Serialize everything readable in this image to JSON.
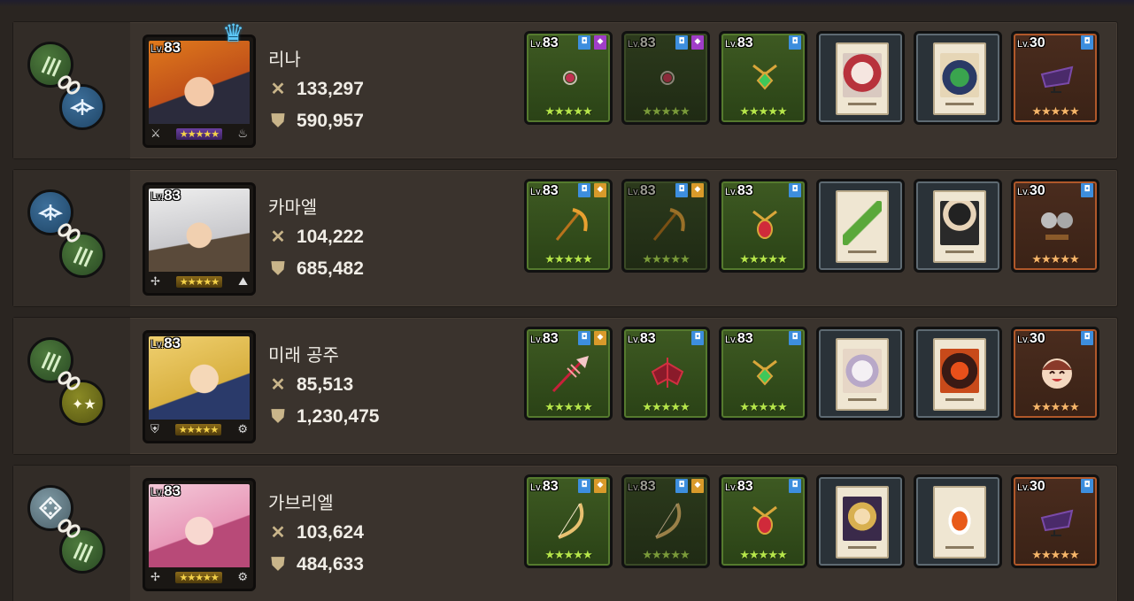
{
  "colors": {
    "row_bg": "#3a332d",
    "stat_text": "#f0ede6",
    "gear_green": "#3e5a22",
    "gear_orange": "#4a2c1e",
    "card_frame": "#2a3238",
    "crown": "#5ec8f8"
  },
  "labels": {
    "lv_prefix": "Lv."
  },
  "heroes": [
    {
      "name": "리나",
      "level": "83",
      "attack": "133,297",
      "defense": "590,957",
      "element_icons": [
        "claw-green-icon",
        "wings-blue-icon"
      ],
      "leader_crown": true,
      "gear": [
        {
          "type": "weapon",
          "level": "83",
          "stars": "★★★★★"
        },
        {
          "type": "weapon-alt",
          "level": "83",
          "stars": "★★★★★"
        },
        {
          "type": "accessory",
          "level": "83",
          "stars": "★★★★★"
        },
        {
          "type": "card"
        },
        {
          "type": "card"
        },
        {
          "type": "relic",
          "level": "30",
          "stars": "★★★★★"
        }
      ]
    },
    {
      "name": "카마엘",
      "level": "83",
      "attack": "104,222",
      "defense": "685,482",
      "element_icons": [
        "wings-blue-icon",
        "claw-green-icon"
      ],
      "leader_crown": false,
      "gear": [
        {
          "type": "weapon",
          "level": "83",
          "stars": "★★★★★"
        },
        {
          "type": "weapon-alt",
          "level": "83",
          "stars": "★★★★★"
        },
        {
          "type": "accessory",
          "level": "83",
          "stars": "★★★★★"
        },
        {
          "type": "card"
        },
        {
          "type": "card"
        },
        {
          "type": "relic",
          "level": "30",
          "stars": "★★★★★"
        }
      ]
    },
    {
      "name": "미래 공주",
      "level": "83",
      "attack": "85,513",
      "defense": "1,230,475",
      "element_icons": [
        "claw-green-icon",
        "stars-yellow-icon"
      ],
      "leader_crown": false,
      "gear": [
        {
          "type": "weapon",
          "level": "83",
          "stars": "★★★★★"
        },
        {
          "type": "weapon-alt",
          "level": "83",
          "stars": "★★★★★"
        },
        {
          "type": "accessory",
          "level": "83",
          "stars": "★★★★★"
        },
        {
          "type": "card"
        },
        {
          "type": "card"
        },
        {
          "type": "relic",
          "level": "30",
          "stars": "★★★★★"
        }
      ]
    },
    {
      "name": "가브리엘",
      "level": "83",
      "attack": "103,624",
      "defense": "484,633",
      "element_icons": [
        "dice-silver-icon",
        "claw-green-icon"
      ],
      "leader_crown": false,
      "gear": [
        {
          "type": "weapon",
          "level": "83",
          "stars": "★★★★★"
        },
        {
          "type": "weapon-alt",
          "level": "83",
          "stars": "★★★★★"
        },
        {
          "type": "accessory",
          "level": "83",
          "stars": "★★★★★"
        },
        {
          "type": "card"
        },
        {
          "type": "card"
        },
        {
          "type": "relic",
          "level": "30",
          "stars": "★★★★★"
        }
      ]
    }
  ],
  "hero_stars": "★★★★★"
}
